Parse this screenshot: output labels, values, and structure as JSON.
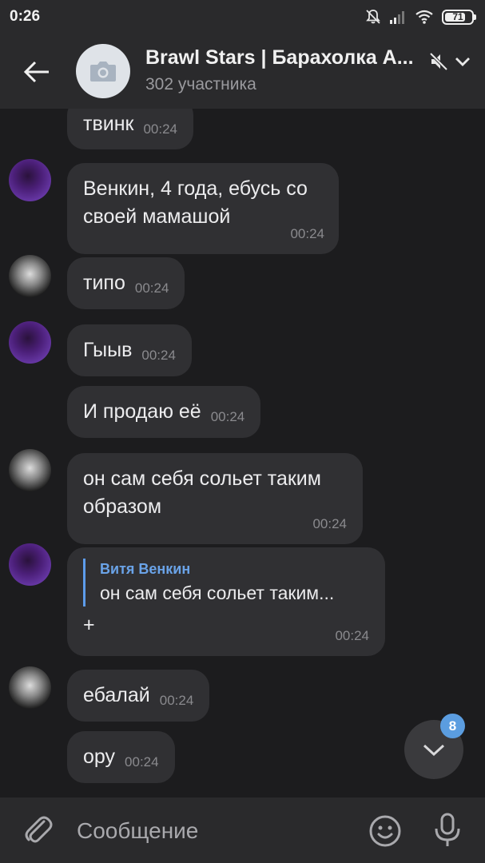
{
  "status_bar": {
    "time": "0:26",
    "battery_level": "71",
    "icons": [
      "bell-off-icon",
      "signal-icon",
      "wifi-icon",
      "battery-icon"
    ]
  },
  "header": {
    "title": "Brawl Stars | Барахолка А...",
    "subtitle": "302 участника",
    "icons": [
      "back-arrow-icon",
      "camera-icon",
      "mute-icon",
      "chevron-down-icon"
    ]
  },
  "messages": [
    {
      "text": "твинк",
      "time": "00:24",
      "avatar": null
    },
    {
      "text": "Венкин, 4 года, ебусь со своей мамашой",
      "time": "00:24",
      "avatar": "purple"
    },
    {
      "text": "типо",
      "time": "00:24",
      "avatar": "white"
    },
    {
      "text": "Гыыв",
      "time": "00:24",
      "avatar": "purple"
    },
    {
      "text": "И продаю её",
      "time": "00:24",
      "avatar": null
    },
    {
      "text": "он сам себя сольет таким образом",
      "time": "00:24",
      "avatar": "white"
    },
    {
      "reply_name": "Витя Венкин",
      "reply_text": "он сам себя сольет таким...",
      "text": "+",
      "time": "00:24",
      "avatar": "purple"
    },
    {
      "text": "ебалай",
      "time": "00:24",
      "avatar": "white"
    },
    {
      "text": "ору",
      "time": "00:24",
      "avatar": null
    }
  ],
  "scroll_down": {
    "badge": "8"
  },
  "composer": {
    "placeholder": "Сообщение"
  },
  "colors": {
    "background": "#1c1c1e",
    "bar": "#2a2a2c",
    "bubble": "#303033",
    "accent": "#5b9de0"
  }
}
